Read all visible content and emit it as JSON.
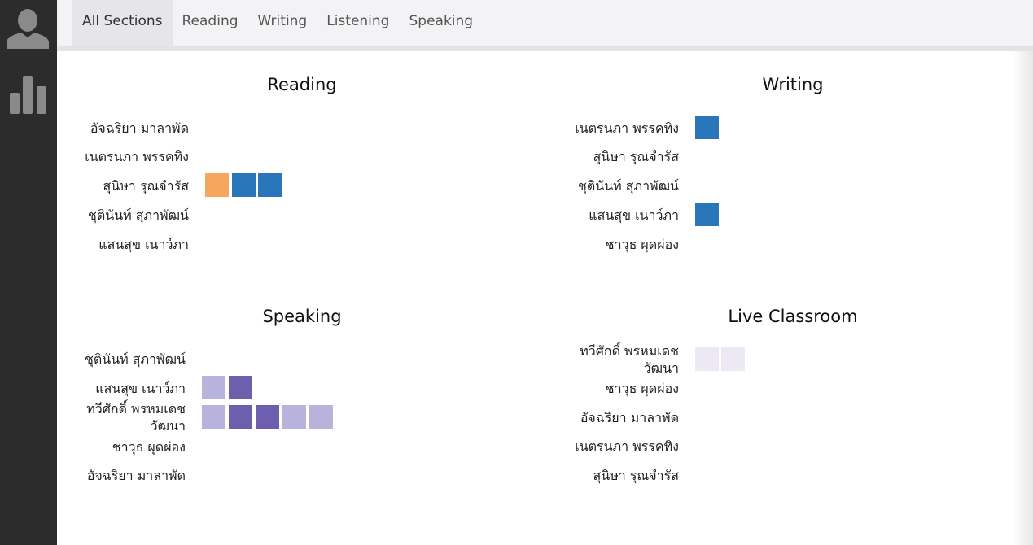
{
  "sidebar": {
    "items": [
      {
        "icon": "user-avatar-icon"
      },
      {
        "icon": "bar-chart-icon"
      }
    ]
  },
  "tabs": [
    {
      "label": "All Sections",
      "active": true
    },
    {
      "label": "Reading",
      "active": false
    },
    {
      "label": "Writing",
      "active": false
    },
    {
      "label": "Listening",
      "active": false
    },
    {
      "label": "Speaking",
      "active": false
    }
  ],
  "colors": {
    "orange": "#f7a75b",
    "blue": "#2a76bb",
    "light_purple": "#b7b3dd",
    "dark_purple": "#6d5fae",
    "very_light_purple": "#ece8f4"
  },
  "panels": {
    "reading": {
      "title": "Reading",
      "rows": [
        {
          "name": "อัจฉริยา มาลาพัด",
          "squares": []
        },
        {
          "name": "เนตรนภา พรรคทิง",
          "squares": []
        },
        {
          "name": "สุนิษา รุณจำรัส",
          "squares": [
            "orange",
            "blue",
            "blue"
          ]
        },
        {
          "name": "ชุตินันท์ สุภาพัฒน์",
          "squares": []
        },
        {
          "name": "แสนสุข เนาว์ภา",
          "squares": []
        }
      ]
    },
    "writing": {
      "title": "Writing",
      "rows": [
        {
          "name": "เนตรนภา พรรคทิง",
          "squares": [
            "blue"
          ]
        },
        {
          "name": "สุนิษา รุณจำรัส",
          "squares": []
        },
        {
          "name": "ชุตินันท์ สุภาพัฒน์",
          "squares": []
        },
        {
          "name": "แสนสุข เนาว์ภา",
          "squares": [
            "blue"
          ]
        },
        {
          "name": "ชาวุธ ผุดผ่อง",
          "squares": []
        }
      ]
    },
    "speaking": {
      "title": "Speaking",
      "rows": [
        {
          "name": "ชุตินันท์ สุภาพัฒน์",
          "squares": []
        },
        {
          "name": "แสนสุข เนาว์ภา",
          "squares": [
            "light_purple",
            "dark_purple"
          ]
        },
        {
          "name": "ทวีศักดิ์ พรหมเดชวัฒนา",
          "squares": [
            "light_purple",
            "dark_purple",
            "dark_purple",
            "light_purple",
            "light_purple"
          ]
        },
        {
          "name": "ชาวุธ ผุดผ่อง",
          "squares": []
        },
        {
          "name": "อัจฉริยา มาลาพัด",
          "squares": []
        }
      ]
    },
    "live_classroom": {
      "title": "Live Classroom",
      "rows": [
        {
          "name": "ทวีศักดิ์ พรหมเดชวัฒนา",
          "squares": [
            "very_light_purple",
            "very_light_purple"
          ]
        },
        {
          "name": "ชาวุธ ผุดผ่อง",
          "squares": []
        },
        {
          "name": "อัจฉริยา มาลาพัด",
          "squares": []
        },
        {
          "name": "เนตรนภา พรรคทิง",
          "squares": []
        },
        {
          "name": "สุนิษา รุณจำรัส",
          "squares": []
        }
      ]
    }
  }
}
